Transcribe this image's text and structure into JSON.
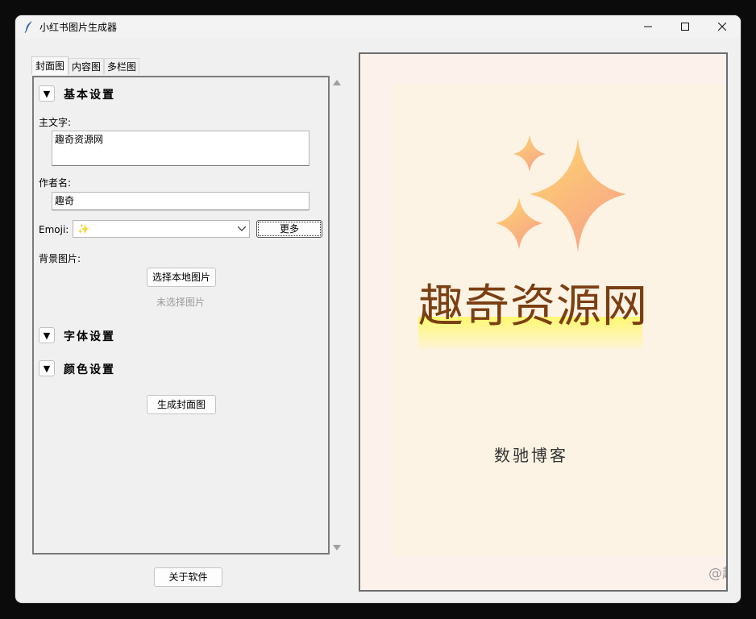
{
  "window": {
    "title": "小红书图片生成器"
  },
  "tabs": [
    {
      "label": "封面图"
    },
    {
      "label": "内容图"
    },
    {
      "label": "多栏图"
    }
  ],
  "sections": {
    "basic": {
      "toggle": "▼",
      "title": "基本设置"
    },
    "font": {
      "toggle": "▼",
      "title": "字体设置"
    },
    "color": {
      "toggle": "▼",
      "title": "颜色设置"
    }
  },
  "form": {
    "main_text_label": "主文字:",
    "main_text_value": "趣奇资源网",
    "author_label": "作者名:",
    "author_value": "趣奇",
    "emoji_label": "Emoji:",
    "emoji_value": "✨",
    "more_button": "更多",
    "bg_label": "背景图片:",
    "choose_image_button": "选择本地图片",
    "no_image_text": "未选择图片",
    "generate_button": "生成封面图"
  },
  "about_button": "关于软件",
  "preview": {
    "main_text": "趣奇资源网",
    "author_text": "数驰博客",
    "watermark": "@趣"
  },
  "colors": {
    "title_text": "#7b3f12",
    "highlight": "#fff870",
    "card_bg": "#fdf3e4",
    "preview_bg": "#fdf1ec"
  }
}
